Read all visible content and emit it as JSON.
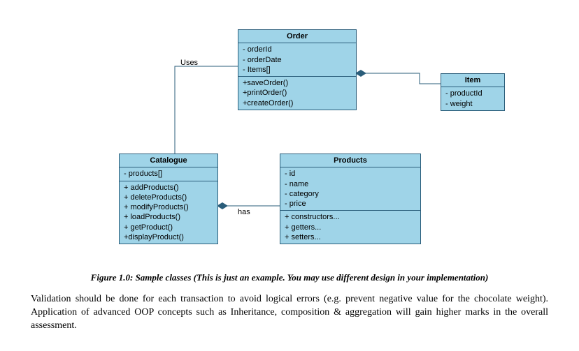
{
  "classes": {
    "order": {
      "name": "Order",
      "attrs": [
        "- orderId",
        "- orderDate",
        "- Items[]"
      ],
      "methods": [
        "+saveOrder()",
        "+printOrder()",
        "+createOrder()"
      ]
    },
    "item": {
      "name": "Item",
      "attrs": [
        "- productId",
        "- weight"
      ]
    },
    "catalogue": {
      "name": "Catalogue",
      "attrs": [
        "- products[]"
      ],
      "methods": [
        "+ addProducts()",
        "+ deleteProducts()",
        "+ modifyProducts()",
        "+ loadProducts()",
        "+ getProduct()",
        "+displayProduct()"
      ]
    },
    "products": {
      "name": "Products",
      "attrs": [
        "- id",
        "- name",
        "- category",
        "- price"
      ],
      "methods": [
        "+ constructors...",
        "+ getters...",
        "+ setters..."
      ]
    }
  },
  "labels": {
    "uses": "Uses",
    "has": "has"
  },
  "caption": "Figure 1.0: Sample classes (This is just an example. You may use different design in your implementation)",
  "paragraph": "Validation should be done for each transaction to avoid logical errors (e.g. prevent negative value for the chocolate weight). Application of advanced OOP concepts such as Inheritance, composition & aggregation will gain higher marks in the overall assessment."
}
